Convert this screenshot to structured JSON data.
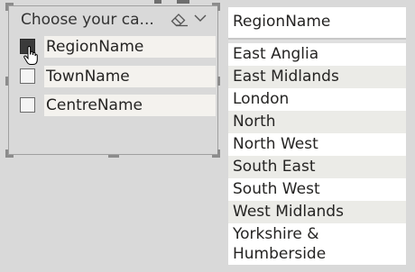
{
  "slicer": {
    "title": "Choose your ca...",
    "fields": [
      {
        "label": "RegionName",
        "checked": true
      },
      {
        "label": "TownName",
        "checked": false
      },
      {
        "label": "CentreName",
        "checked": false
      }
    ]
  },
  "table": {
    "header": "RegionName",
    "rows": [
      "East Anglia",
      "East Midlands",
      "London",
      "North",
      "North West",
      "South East",
      "South West",
      "West Midlands",
      "Yorkshire &\nHumberside"
    ]
  },
  "icons": {
    "clear": "eraser-icon",
    "dropdown": "chevron-down-icon",
    "cursor": "hand-pointer-icon"
  }
}
